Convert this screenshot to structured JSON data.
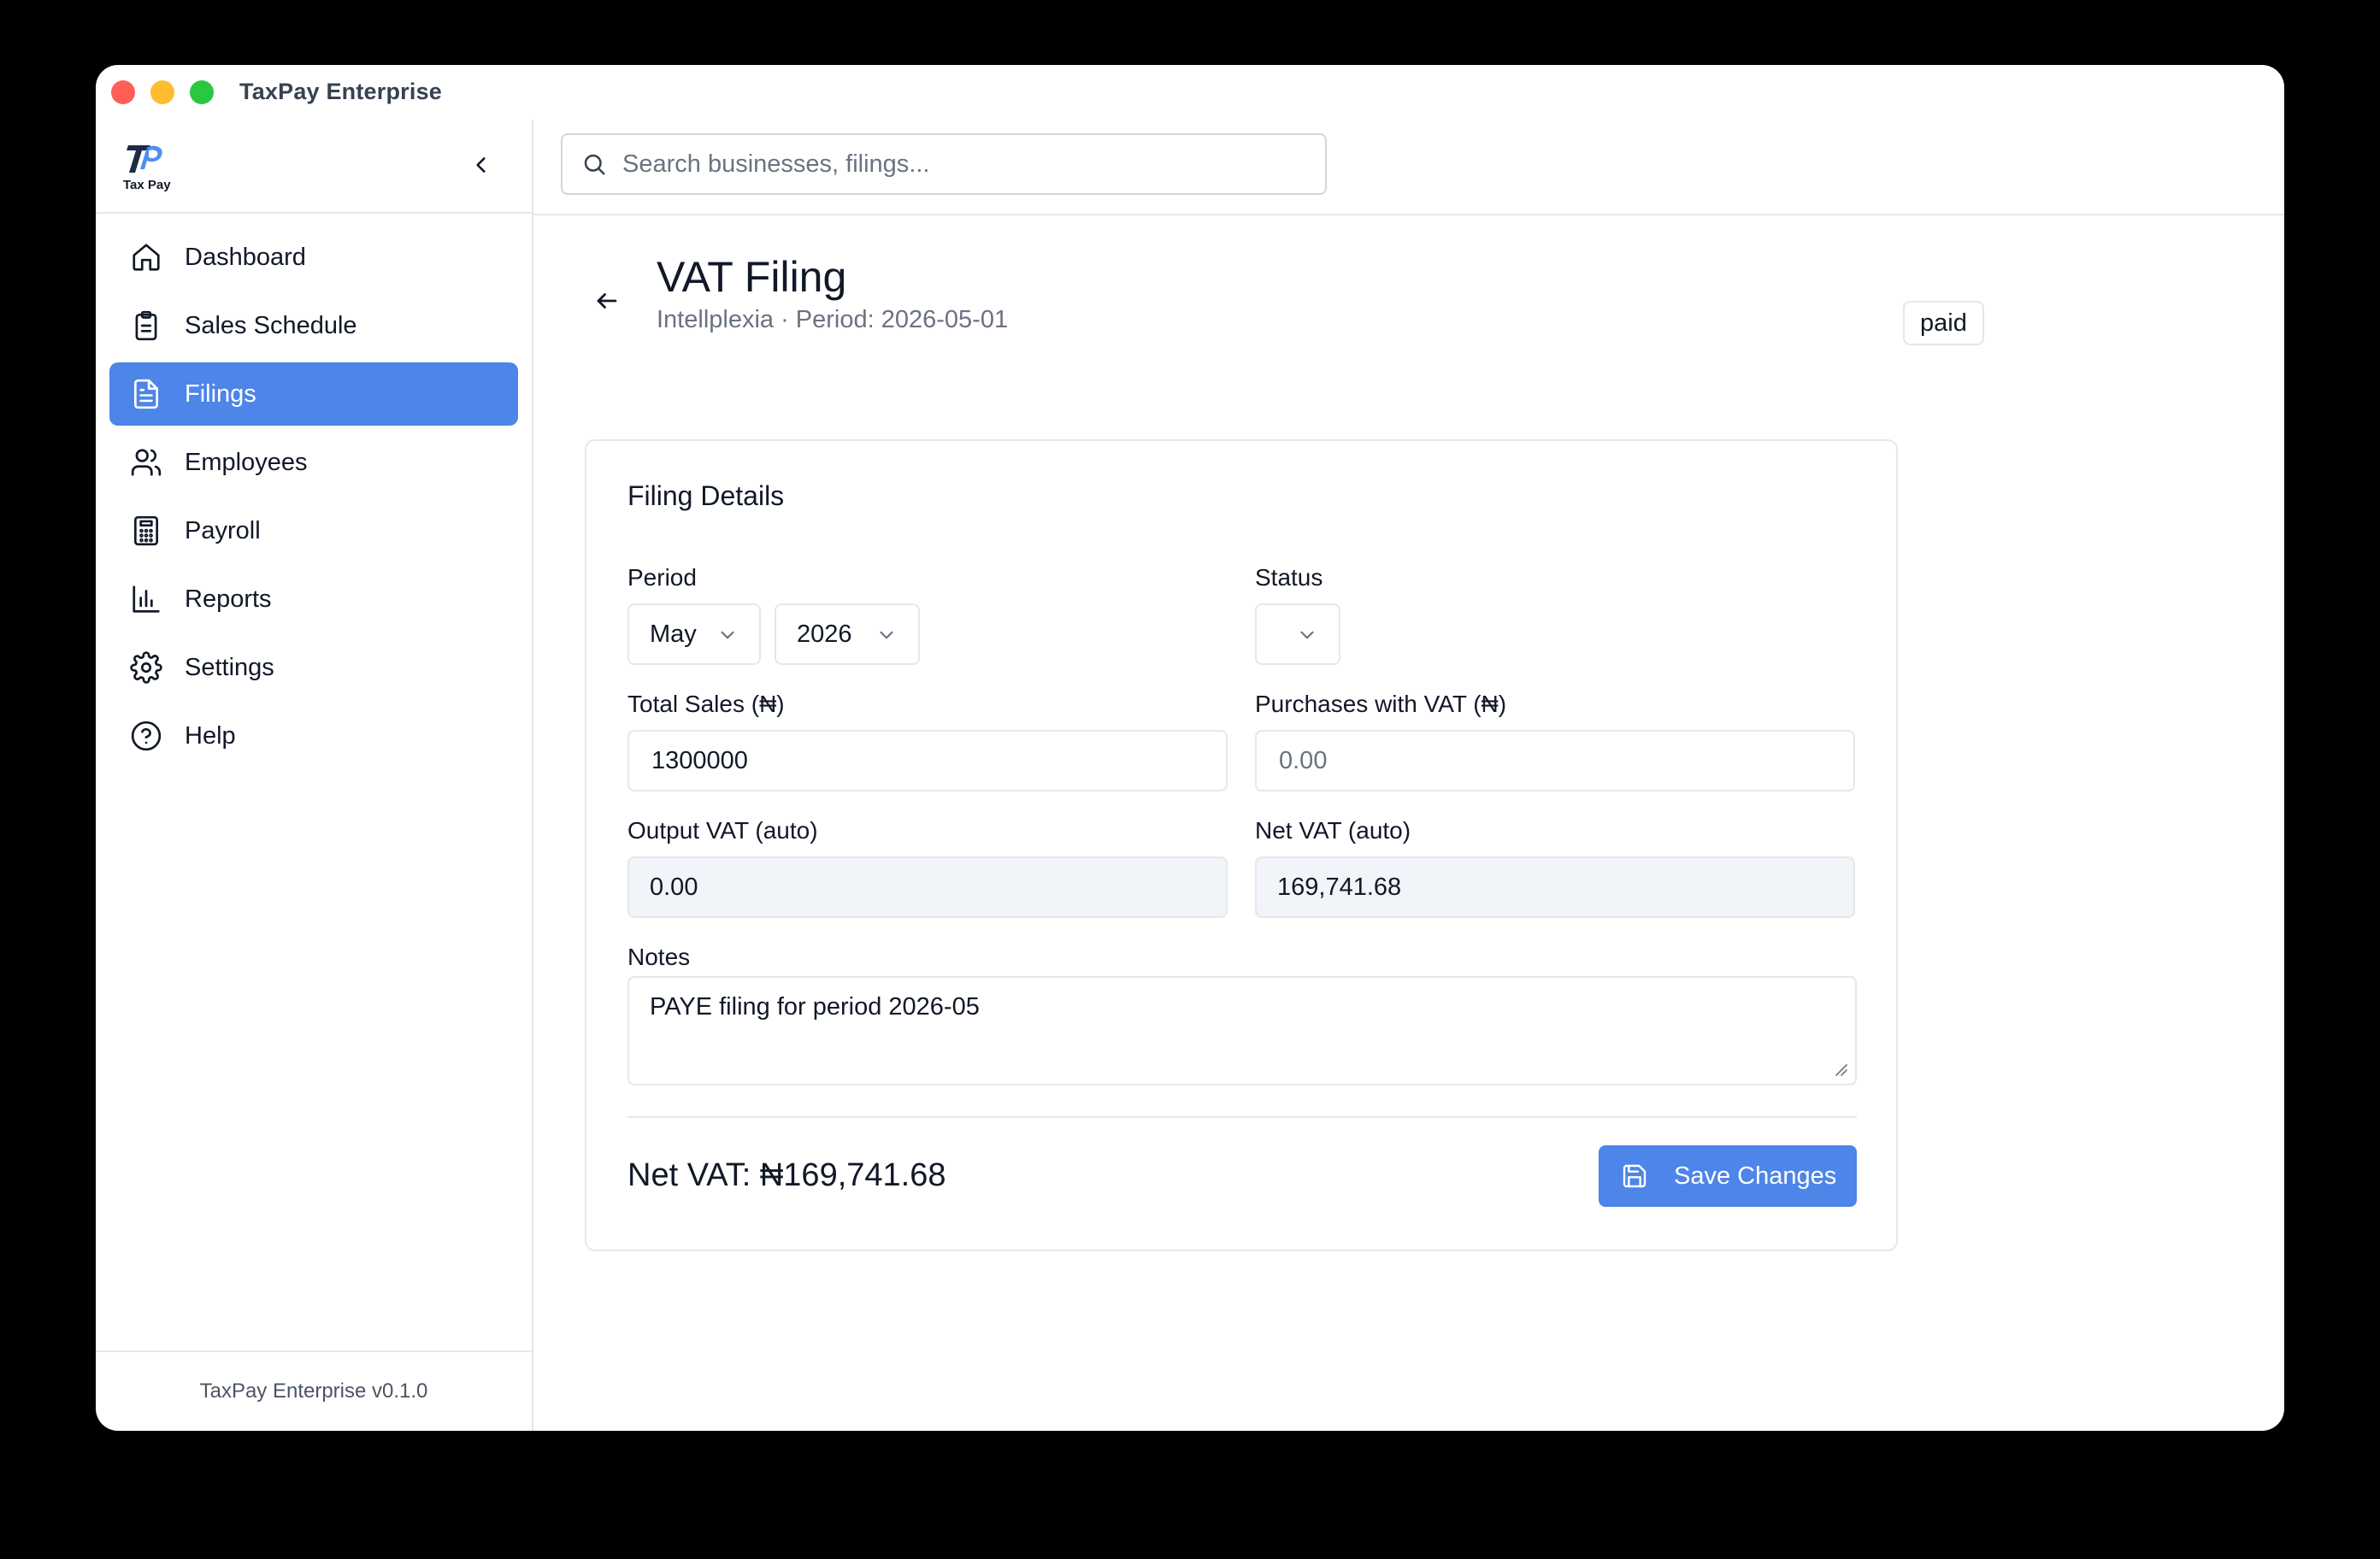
{
  "window": {
    "title": "TaxPay Enterprise"
  },
  "sidebar": {
    "logo_text": "Tax Pay",
    "items": [
      {
        "label": "Dashboard",
        "icon": "home-icon",
        "active": false
      },
      {
        "label": "Sales Schedule",
        "icon": "clipboard-icon",
        "active": false
      },
      {
        "label": "Filings",
        "icon": "document-icon",
        "active": true
      },
      {
        "label": "Employees",
        "icon": "users-icon",
        "active": false
      },
      {
        "label": "Payroll",
        "icon": "calculator-icon",
        "active": false
      },
      {
        "label": "Reports",
        "icon": "bar-chart-icon",
        "active": false
      },
      {
        "label": "Settings",
        "icon": "gear-icon",
        "active": false
      },
      {
        "label": "Help",
        "icon": "help-circle-icon",
        "active": false
      }
    ],
    "footer": "TaxPay Enterprise v0.1.0"
  },
  "search": {
    "placeholder": "Search businesses, filings...",
    "value": ""
  },
  "page": {
    "title": "VAT Filing",
    "subtitle": "Intellplexia · Period: 2026-05-01",
    "status_badge": "paid"
  },
  "card": {
    "title": "Filing Details",
    "period_label": "Period",
    "month": "May",
    "year": "2026",
    "status_label": "Status",
    "status_value": "",
    "total_sales_label": "Total Sales (₦)",
    "total_sales_value": "1300000",
    "purchases_label": "Purchases with VAT (₦)",
    "purchases_value": "",
    "purchases_placeholder": "0.00",
    "output_vat_label": "Output VAT (auto)",
    "output_vat_value": "0.00",
    "net_vat_label": "Net VAT (auto)",
    "net_vat_value": "169,741.68",
    "notes_label": "Notes",
    "notes_value": "PAYE filing for period 2026-05",
    "net_total": "Net VAT: ₦169,741.68",
    "save_label": "Save Changes"
  },
  "colors": {
    "accent": "#4d85e8",
    "border": "#e5e7eb",
    "readonly_bg": "#f1f4f8",
    "muted_text": "#6b7280"
  }
}
